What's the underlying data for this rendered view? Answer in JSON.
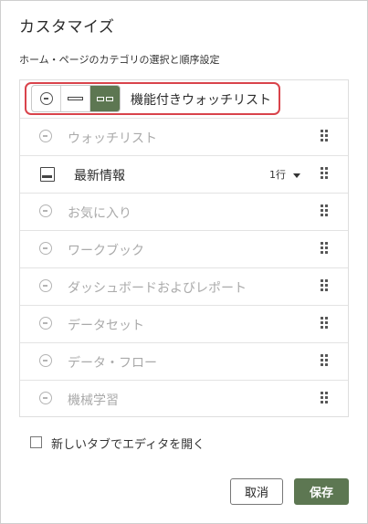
{
  "dialog": {
    "title": "カスタマイズ",
    "subtitle": "ホーム・ページのカテゴリの選択と順序設定"
  },
  "categories": [
    {
      "label": "機能付きウォッチリスト",
      "state": "wide",
      "enabled": true,
      "highlighted": true,
      "icon": "segmented-layout-control"
    },
    {
      "label": "ウォッチリスト",
      "enabled": false,
      "icon": "minus-circle-icon"
    },
    {
      "label": "最新情報",
      "enabled": true,
      "icon": "news-icon",
      "rows_value": "1行"
    },
    {
      "label": "お気に入り",
      "enabled": false,
      "icon": "minus-circle-icon"
    },
    {
      "label": "ワークブック",
      "enabled": false,
      "icon": "minus-circle-icon"
    },
    {
      "label": "ダッシュボードおよびレポート",
      "enabled": false,
      "icon": "minus-circle-icon"
    },
    {
      "label": "データセット",
      "enabled": false,
      "icon": "minus-circle-icon"
    },
    {
      "label": "データ・フロー",
      "enabled": false,
      "icon": "minus-circle-icon"
    },
    {
      "label": "機械学習",
      "enabled": false,
      "icon": "minus-circle-icon"
    }
  ],
  "open_in_new_tab": {
    "label": "新しいタブでエディタを開く",
    "checked": false
  },
  "buttons": {
    "cancel": "取消",
    "save": "保存"
  },
  "colors": {
    "accent": "#5d7752",
    "highlight_border": "#d9434b",
    "disabled_text": "#aaaaaa"
  }
}
